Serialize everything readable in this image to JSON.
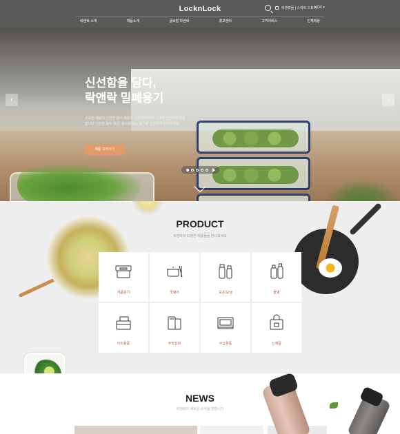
{
  "header": {
    "logo": "LocknLock",
    "user_links": "락앤락몰 | 스마트 스토어",
    "language": "KOR",
    "nav": [
      "락앤락 소개",
      "제품소개",
      "글로벌 락앤락",
      "홍보센터",
      "고객서비스",
      "인재채용"
    ]
  },
  "hero": {
    "title_line1": "신선함을 담다,",
    "title_line2": "락앤락 밀폐용기",
    "description": "소중한 재료의 신선한 음식 재료가 오래 보관되어 그대로 신선하게 되찾습니다 신선한 음식 보관, 용도에 맞는 용기로 신선하게 보관하세요",
    "cta_label": "제품 보러가기",
    "slide_count": 5,
    "active_slide": 1
  },
  "product": {
    "title": "PRODUCT",
    "subtitle": "락앤락의 다양한 제품들을 만나보세요",
    "categories": [
      {
        "label": "식품용기",
        "icon": "food-container-icon"
      },
      {
        "label": "쿡웨어",
        "icon": "cookware-icon"
      },
      {
        "label": "보온/보냉",
        "icon": "thermos-icon"
      },
      {
        "label": "물병",
        "icon": "water-bottle-icon"
      },
      {
        "label": "아외용품",
        "icon": "outdoor-box-icon"
      },
      {
        "label": "주방잡화",
        "icon": "kitchen-tools-icon"
      },
      {
        "label": "수납용품",
        "icon": "storage-icon"
      },
      {
        "label": "신제품",
        "icon": "new-product-bag-icon"
      }
    ]
  },
  "news": {
    "title": "NEWS",
    "subtitle": "락앤락의 새로운 소식을 전합니다"
  }
}
